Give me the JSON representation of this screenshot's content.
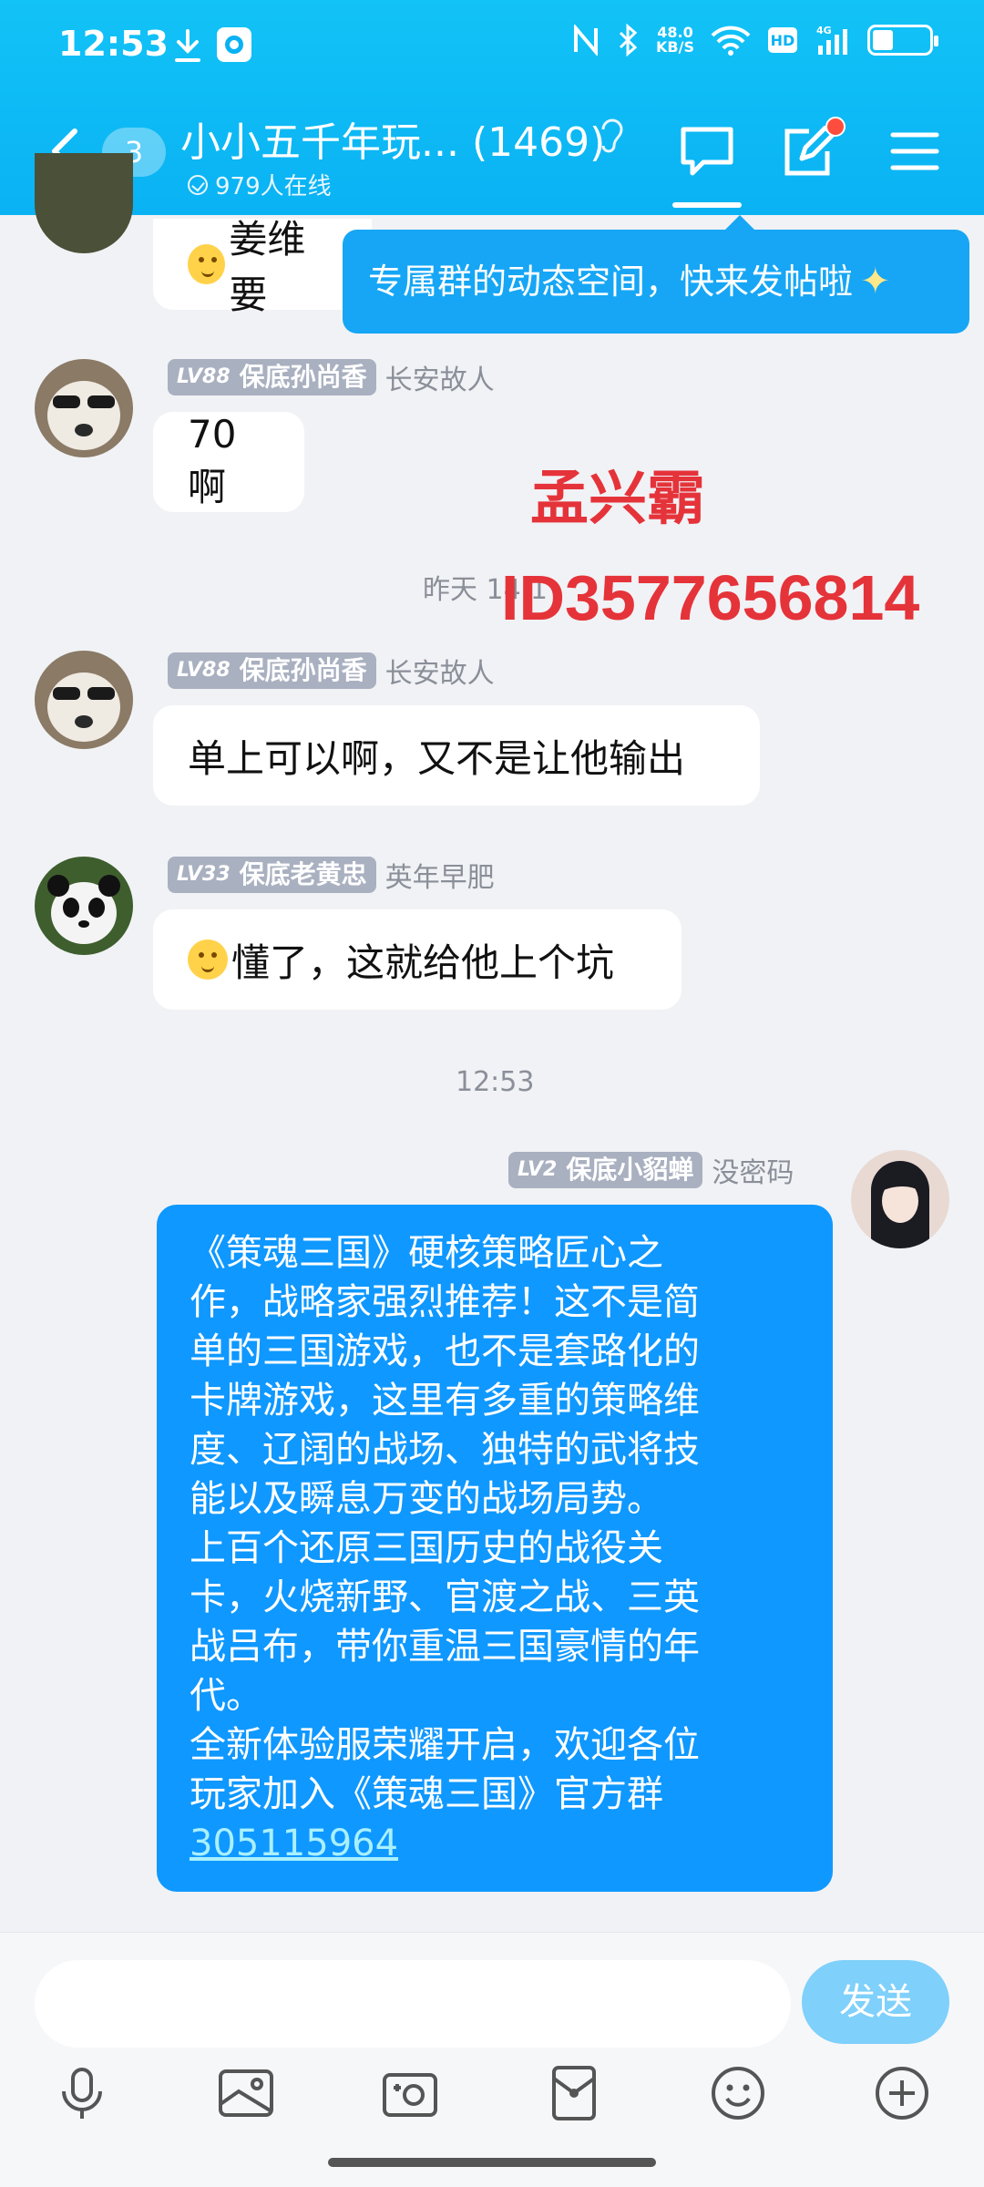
{
  "status": {
    "time": "12:53",
    "speed_top": "48.0",
    "speed_bottom": "KB/S",
    "net": "4G"
  },
  "header": {
    "back_badge": "3",
    "title": "小小五千年玩... (1469)",
    "online": "979人在线"
  },
  "tooltip": {
    "text": "专属群的动态空间，快来发帖啦"
  },
  "messages": [
    {
      "text_partial": "姜维要"
    },
    {
      "level": "LV88",
      "name": "保底孙尚香",
      "title": "长安故人",
      "text": "70啊"
    },
    {
      "level": "LV88",
      "name": "保底孙尚香",
      "title": "长安故人",
      "text": "单上可以啊，又不是让他输出"
    },
    {
      "level": "LV33",
      "name": "保底老黄忠",
      "title": "英年早肥",
      "text": "懂了，这就给他上个坑"
    }
  ],
  "timestamps": {
    "yesterday": "昨天 14:1",
    "now": "12:53"
  },
  "watermark": {
    "name": "孟兴霸",
    "id": "ID3577656814"
  },
  "my_message": {
    "level": "LV2",
    "name": "保底小貂蝉",
    "title": "没密码",
    "text": "《策魂三国》硬核策略匠心之\n作，战略家强烈推荐！这不是简\n单的三国游戏，也不是套路化的\n卡牌游戏，这里有多重的策略维\n度、辽阔的战场、独特的武将技\n能以及瞬息万变的战场局势。\n上百个还原三国历史的战役关\n卡，火烧新野、官渡之战、三英\n战吕布，带你重温三国豪情的年\n代。\n全新体验服荣耀开启，欢迎各位\n玩家加入《策魂三国》官方群\n",
    "link": "305115964"
  },
  "composer": {
    "placeholder": "",
    "send_label": "发送"
  },
  "colors": {
    "header": "#0ab2f3",
    "my_bubble": "#0f98ff",
    "watermark": "#e5333a"
  }
}
